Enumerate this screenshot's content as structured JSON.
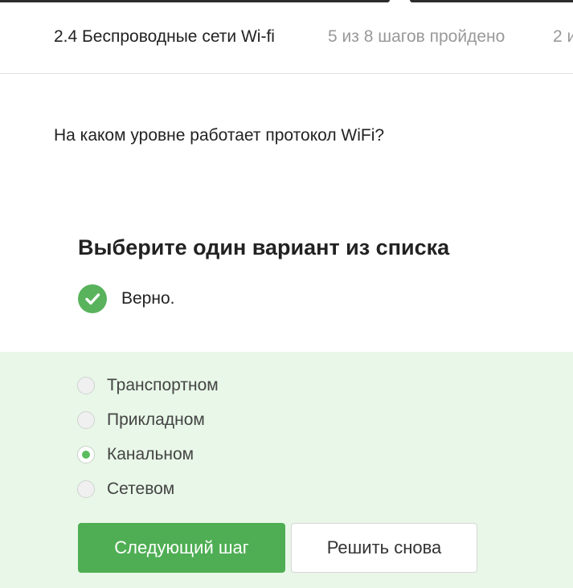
{
  "header": {
    "lesson_title": "2.4 Беспроводные сети Wi-fi",
    "progress_text": "5 из 8 шагов пройдено",
    "extra_text": "2 и"
  },
  "step": {
    "question": "На каком уровне работает протокол WiFi?"
  },
  "quiz": {
    "title": "Выберите один вариант из списка",
    "verdict": "Верно.",
    "verdict_icon": "check-circle-icon",
    "accent_color": "#59b35d",
    "options": [
      {
        "label": "Транспортном",
        "selected": false
      },
      {
        "label": "Прикладном",
        "selected": false
      },
      {
        "label": "Канальном",
        "selected": true
      },
      {
        "label": "Сетевом",
        "selected": false
      }
    ]
  },
  "actions": {
    "next_label": "Следующий шаг",
    "retry_label": "Решить снова"
  }
}
